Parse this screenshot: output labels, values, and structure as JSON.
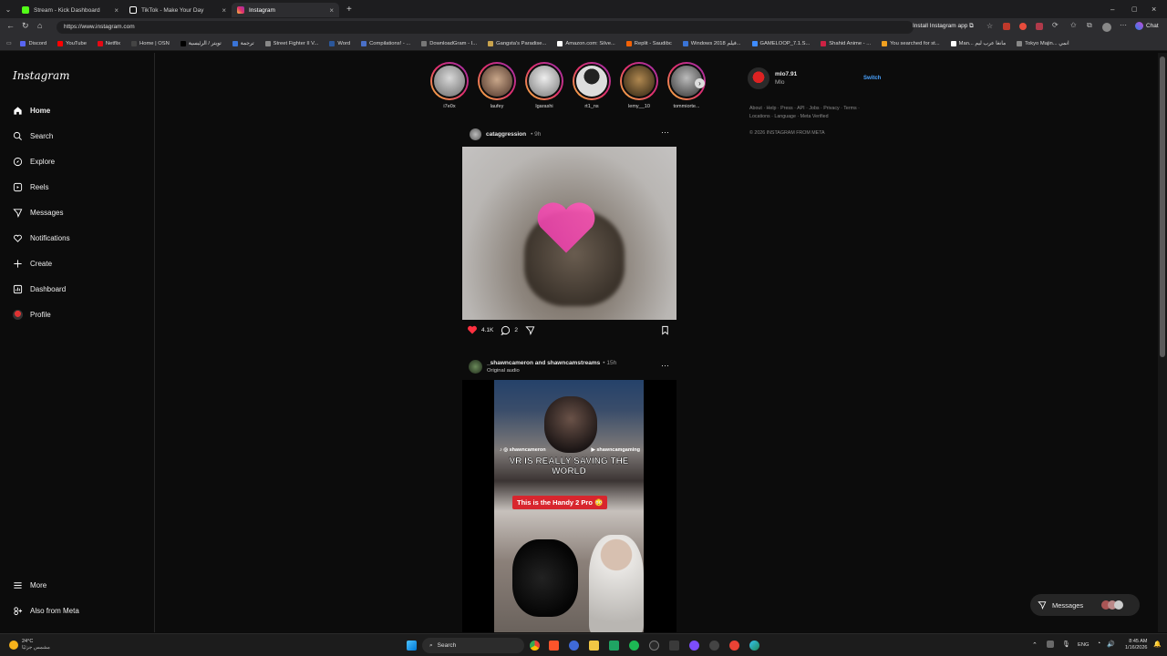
{
  "browser": {
    "tabs": [
      {
        "label": "Stream - Kick Dashboard",
        "color": "#53fc18"
      },
      {
        "label": "TikTok - Make Your Day",
        "color": "#ffffff"
      },
      {
        "label": "Instagram",
        "color": "#e1306c"
      }
    ],
    "url": "https://www.instagram.com",
    "install_label": "Install Instagram app",
    "chat_label": "Chat",
    "bookmarks": [
      "Discord",
      "YouTube",
      "Netflix",
      "Home | OSN",
      "تويتر / الرئيسية",
      "ترجمة",
      "Street Fighter II V...",
      "Word",
      "Compilations! - ...",
      "DownloadGram - I...",
      "Gangsta's Paradise...",
      "Amazon.com: Silve...",
      "Replit - Saudibc",
      "Windows 2018 فيلم...",
      "GAMELOOP_7.1.S...",
      "Shahid Anime - ...",
      "You searched for st...",
      "Man... مانغا عرب ليم",
      "Tokyo Majin... انمي"
    ]
  },
  "sidebar": {
    "logo": "Instagram",
    "items": [
      {
        "label": "Home",
        "icon": "home-icon"
      },
      {
        "label": "Search",
        "icon": "search-icon"
      },
      {
        "label": "Explore",
        "icon": "compass-icon"
      },
      {
        "label": "Reels",
        "icon": "reels-icon"
      },
      {
        "label": "Messages",
        "icon": "send-icon"
      },
      {
        "label": "Notifications",
        "icon": "heart-icon"
      },
      {
        "label": "Create",
        "icon": "plus-icon"
      },
      {
        "label": "Dashboard",
        "icon": "dashboard-icon"
      },
      {
        "label": "Profile",
        "icon": "avatar"
      }
    ],
    "more_label": "More",
    "meta_label": "Also from Meta"
  },
  "stories": [
    {
      "name": "i7e0x",
      "color": "#9a9a9a"
    },
    {
      "name": "laufey",
      "color": "#7a5a4a"
    },
    {
      "name": "lgarashi",
      "color": "#b0b0b0"
    },
    {
      "name": "rt1_ns",
      "color": "#c8c8c8"
    },
    {
      "name": "lemy__10",
      "color": "#6a5a3a"
    },
    {
      "name": "tommiorte...",
      "color": "#5a5a5a"
    }
  ],
  "post1": {
    "username": "cataggression",
    "time": "• 9h",
    "likes": "4.1K",
    "comments": "2"
  },
  "post2": {
    "username": "_shawncameron and shawncamstreams",
    "time": "• 15h",
    "audio": "Original audio",
    "overlay_handle_left": "shawncameron",
    "overlay_handle_right": "shawncamgaming",
    "caption_big": "VR IS REALLY SAVING THE WORLD",
    "caption_tag": "This is the Handy 2 Pro 😳"
  },
  "suggest": {
    "username": "mlo7.91",
    "name": "Mlo",
    "switch": "Switch",
    "footer_links_1": "About · Help · Press · API · Jobs · Privacy · Terms ·",
    "footer_links_2": "Locations · Language · Meta Verified",
    "copyright": "© 2026 INSTAGRAM FROM META"
  },
  "messages_btn": "Messages",
  "taskbar": {
    "weather_temp": "24°C",
    "weather_text": "مشمس جزئيًا",
    "search": "Search",
    "lang": "ENG",
    "time": "8:45 AM",
    "date": "1/16/2026"
  }
}
